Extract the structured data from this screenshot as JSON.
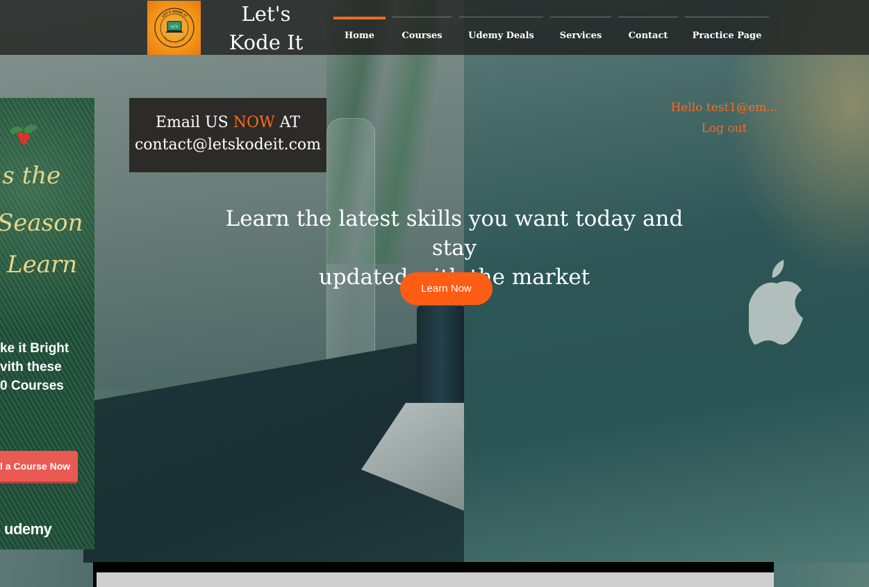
{
  "brand": {
    "name_line1": "Let's",
    "name_line2": "Kode It",
    "logo_text_top": "LET'S KODE IT",
    "logo_text_bottom": "Anyone Can Code",
    "accent_color": "#ff6a1a"
  },
  "nav": {
    "items": [
      {
        "label": "Home",
        "active": true
      },
      {
        "label": "Courses",
        "active": false
      },
      {
        "label": "Udemy Deals",
        "active": false
      },
      {
        "label": "Services",
        "active": false
      },
      {
        "label": "Contact",
        "active": false
      },
      {
        "label": "Practice Page",
        "active": false
      }
    ]
  },
  "promo": {
    "script_line1": "'s the",
    "script_line2": "Season",
    "script_line3": "Learn",
    "tag_line1": "ke it Bright",
    "tag_line2": "vith these",
    "tag_line3": "0 Courses",
    "button_label": "l a Course Now",
    "brand": "udemy"
  },
  "email": {
    "prefix": "Email US",
    "highlight": "NOW",
    "suffix": "AT",
    "address": "contact@letskodeit.com"
  },
  "user": {
    "greeting": "Hello test1@em...",
    "logout_label": "Log out"
  },
  "hero": {
    "line1": "Learn the latest skills you want today and stay",
    "line2": "updated with the market",
    "cta_label": "Learn Now"
  }
}
